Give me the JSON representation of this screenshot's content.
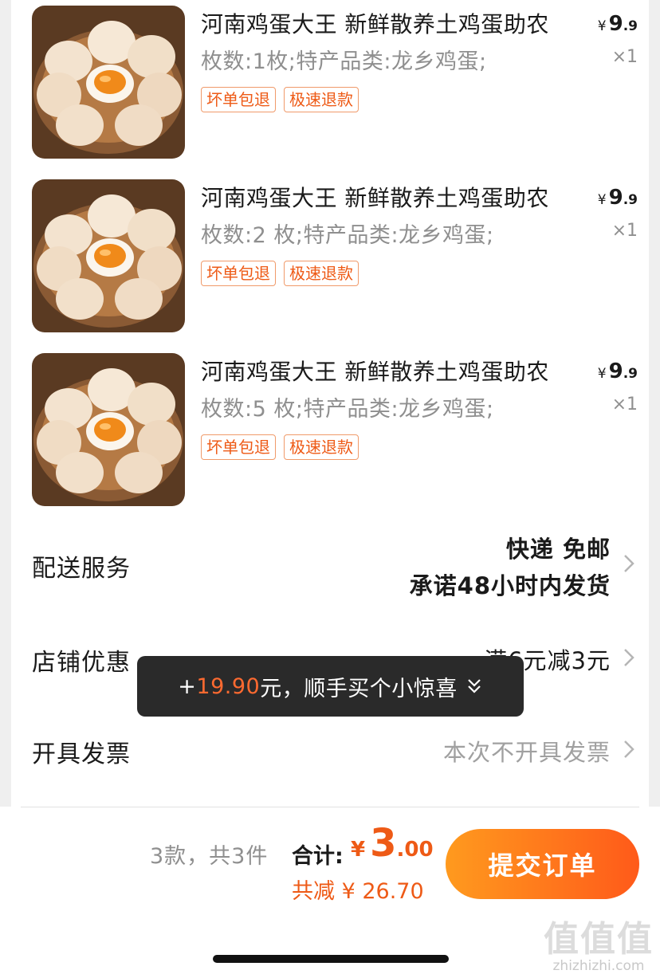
{
  "products": [
    {
      "title": "河南鸡蛋大王 新鲜散养土鸡蛋助农",
      "spec": "枚数:1枚;特产品类:龙乡鸡蛋;",
      "tags": [
        "坏单包退",
        "极速退款"
      ],
      "price_symbol": "¥",
      "price_int": "9",
      "price_dec": ".9",
      "qty": "×1"
    },
    {
      "title": "河南鸡蛋大王 新鲜散养土鸡蛋助农",
      "spec": "枚数:2 枚;特产品类:龙乡鸡蛋;",
      "tags": [
        "坏单包退",
        "极速退款"
      ],
      "price_symbol": "¥",
      "price_int": "9",
      "price_dec": ".9",
      "qty": "×1"
    },
    {
      "title": "河南鸡蛋大王 新鲜散养土鸡蛋助农",
      "spec": "枚数:5 枚;特产品类:龙乡鸡蛋;",
      "tags": [
        "坏单包退",
        "极速退款"
      ],
      "price_symbol": "¥",
      "price_int": "9",
      "price_dec": ".9",
      "qty": "×1"
    }
  ],
  "delivery": {
    "label": "配送服务",
    "line1": "快递 免邮",
    "line2": "承诺48小时内发货"
  },
  "shop_discount": {
    "label": "店铺优惠",
    "value": "满6元减3元"
  },
  "invoice": {
    "label": "开具发票",
    "value": "本次不开具发票"
  },
  "toast": {
    "prefix": "+",
    "amount": "19.90",
    "suffix": "元，顺手买个小惊喜"
  },
  "footer": {
    "count_text": "3款，共3件",
    "total_label": "合计:",
    "total_symbol": "¥",
    "total_int": "3",
    "total_dec": ".00",
    "saving_text": "共减 ¥ 26.70",
    "submit_label": "提交订单"
  },
  "watermark": {
    "big": "值值值",
    "small": "zhizhizhi.com"
  },
  "colors": {
    "accent": "#ee5a16",
    "button_start": "#ff9a1e",
    "button_end": "#ff5a1a",
    "toast_bg": "#2a2a2a"
  }
}
